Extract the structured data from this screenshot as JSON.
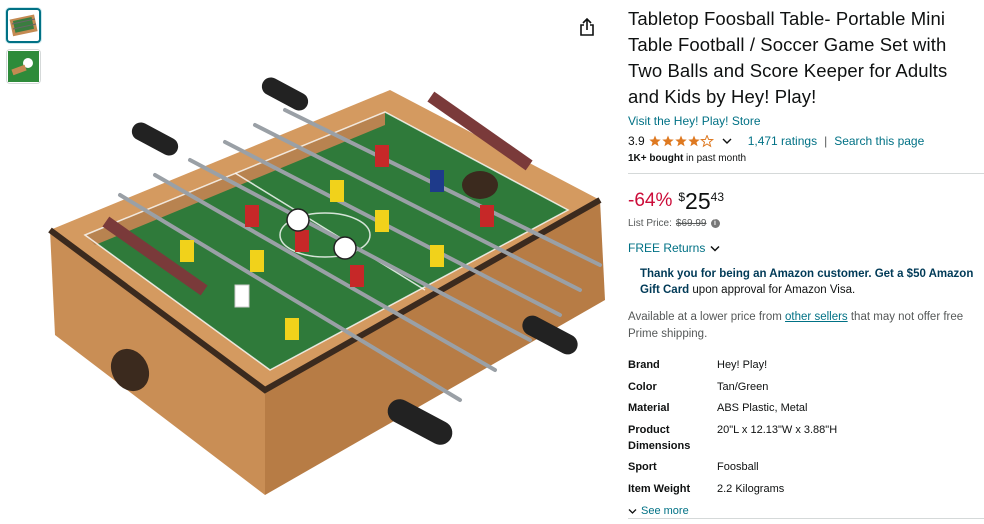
{
  "product": {
    "title": "Tabletop Foosball Table- Portable Mini Table Football / Soccer Game Set with Two Balls and Score Keeper for Adults and Kids by Hey! Play!",
    "store_link": "Visit the Hey! Play! Store",
    "rating_value": "3.9",
    "rating_stars": 3.9,
    "rating_count": "1,471 ratings",
    "separator": "|",
    "search_page": "Search this page",
    "bought_bold": "1K+ bought",
    "bought_rest": " in past month"
  },
  "price": {
    "discount": "-64%",
    "currency": "$",
    "whole": "25",
    "fraction": "43",
    "list_label": "List Price:",
    "list_value": "$69.99",
    "info_icon": "i"
  },
  "returns": {
    "label": "FREE Returns"
  },
  "promo": {
    "strong": "Thank you for being an Amazon customer. Get a $50 Amazon Gift Card",
    "rest": " upon approval for Amazon Visa."
  },
  "availability": {
    "before": "Available at a lower price from ",
    "link": "other sellers",
    "after": " that may not offer free Prime shipping."
  },
  "specs": [
    {
      "key": "Brand",
      "value": "Hey! Play!"
    },
    {
      "key": "Color",
      "value": "Tan/Green"
    },
    {
      "key": "Material",
      "value": "ABS Plastic, Metal"
    },
    {
      "key": "Product Dimensions",
      "value": "20\"L x 12.13\"W x 3.88\"H"
    },
    {
      "key": "Sport",
      "value": "Foosball"
    },
    {
      "key": "Item Weight",
      "value": "2.2 Kilograms"
    }
  ],
  "see_more": "See more",
  "icons": {
    "share": "share-icon",
    "star": "star-icon",
    "chevron": "chevron-down-icon",
    "info": "info-icon"
  },
  "colors": {
    "link": "#007185",
    "deal": "#CC0C39",
    "star": "#DE7921",
    "text": "#0F1111",
    "muted": "#565959",
    "border": "#d5d9d9",
    "table_green": "#2f7a3a",
    "wood": "#c48a52"
  }
}
